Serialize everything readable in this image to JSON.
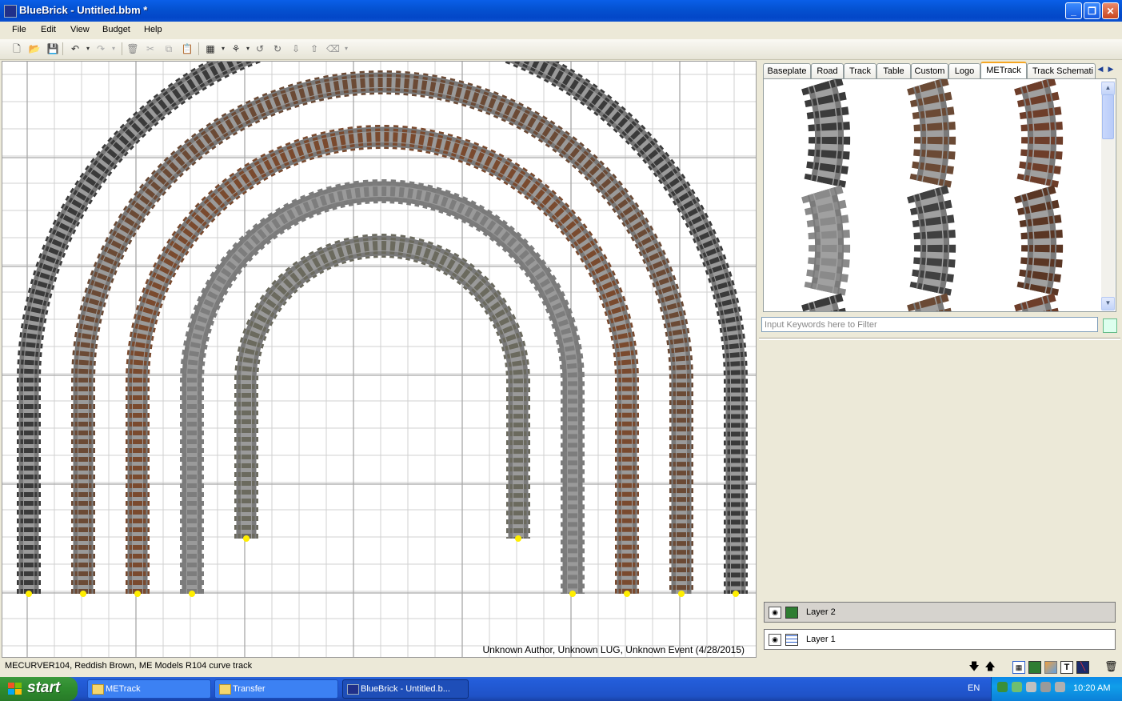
{
  "window": {
    "title": "BlueBrick - Untitled.bbm *",
    "icon": "bluebrick-app-icon",
    "controls": [
      "minimize",
      "restore",
      "close"
    ]
  },
  "menu": [
    "File",
    "Edit",
    "View",
    "Budget",
    "Help"
  ],
  "toolbar": {
    "icons": [
      "new-icon",
      "open-icon",
      "save-icon",
      "undo-icon",
      "redo-icon",
      "delete-icon",
      "cut-icon",
      "copy-icon",
      "paste-icon",
      "snap-grid-icon",
      "paint-icon",
      "rotate-left-icon",
      "rotate-right-icon",
      "send-back-icon",
      "bring-front-icon",
      "eraser-icon"
    ]
  },
  "canvas": {
    "credit": "Unknown Author, Unknown LUG, Unknown Event (4/28/2015)",
    "grid": true,
    "colors": {
      "grid_minor": "#d0d0d0",
      "grid_major": "#a8a8a8",
      "connection_point": "#ffee00"
    },
    "tracks": [
      {
        "name": "arc-1",
        "color": "#3a3a3a"
      },
      {
        "name": "arc-2",
        "color": "#6b4a35"
      },
      {
        "name": "arc-3",
        "color": "#7a4a2e"
      },
      {
        "name": "arc-4",
        "color": "#7d7d7d"
      },
      {
        "name": "arc-5",
        "color": "#6b6a5e"
      }
    ]
  },
  "status": {
    "text": "MECURVER104, Reddish Brown, ME Models R104 curve track"
  },
  "parts_panel": {
    "tabs": [
      "Baseplate",
      "Road",
      "Track",
      "Table",
      "Custom",
      "Logo",
      "METrack",
      "Track Schemati"
    ],
    "active_tab": "METrack",
    "filter_placeholder": "Input Keywords here to Filter",
    "part_colors": [
      "#3a3a3a",
      "#6b4a35",
      "#6e3e2a",
      "#8a8a8a",
      "#404040",
      "#5a3624"
    ]
  },
  "layers": [
    {
      "name": "Layer 2",
      "type": "bricks",
      "selected": true
    },
    {
      "name": "Layer 1",
      "type": "grid",
      "selected": false
    }
  ],
  "taskbar": {
    "start": "start",
    "tasks": [
      {
        "label": "METrack",
        "icon": "folder-icon"
      },
      {
        "label": "Transfer",
        "icon": "folder-icon"
      },
      {
        "label": "BlueBrick - Untitled.b...",
        "icon": "bluebrick-app-icon",
        "active": true
      }
    ],
    "language": "EN",
    "clock": "10:20 AM"
  }
}
